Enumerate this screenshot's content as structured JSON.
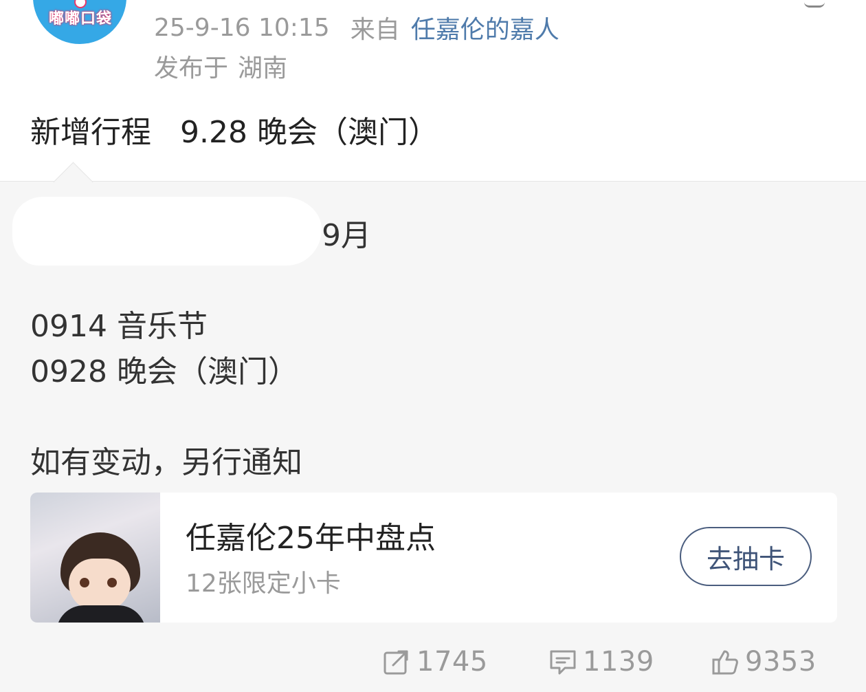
{
  "post": {
    "avatar_text": "嘟嘟口袋",
    "timestamp": "25-9-16 10:15",
    "from_label": "来自",
    "source": "任嘉伦的嘉人",
    "location_prefix": "发布于",
    "location": "湖南",
    "text_prefix": "新增行程",
    "text_event": "9.28 晚会（澳门）"
  },
  "retweet": {
    "month": "9月",
    "lines": [
      "0914 音乐节",
      "0928 晚会（澳门）",
      "如有变动，另行通知"
    ]
  },
  "card": {
    "title": "任嘉伦25年中盘点",
    "subtitle": "12张限定小卡",
    "button_label": "去抽卡"
  },
  "actions": {
    "repost": {
      "count": "1745",
      "icon": "share-box-icon"
    },
    "comment": {
      "count": "1139",
      "icon": "comment-bubble-icon"
    },
    "like": {
      "count": "9353",
      "icon": "thumbs-up-icon"
    }
  },
  "colors": {
    "link": "#4f7bab",
    "meta": "#9a9a9a",
    "avatar_bg": "#35a8e6",
    "card_button": "#4a5d7e"
  }
}
